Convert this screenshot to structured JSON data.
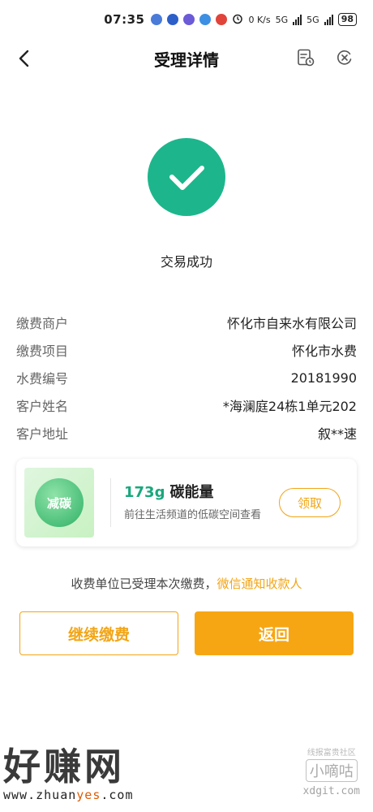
{
  "status_bar": {
    "time": "07:35",
    "net_speed": "0 K/s",
    "sig1": "5G",
    "sig2": "5G",
    "battery": "98"
  },
  "header": {
    "title": "受理详情"
  },
  "success": {
    "text": "交易成功"
  },
  "details": [
    {
      "label": "缴费商户",
      "value": "怀化市自来水有限公司"
    },
    {
      "label": "缴费项目",
      "value": "怀化市水费"
    },
    {
      "label": "水费编号",
      "value": "20181990"
    },
    {
      "label": "客户姓名",
      "value": "*海澜庭24栋1单元202"
    },
    {
      "label": "客户地址",
      "value": "叙**速"
    }
  ],
  "carbon_card": {
    "badge": "减碳",
    "amount": "173g",
    "title": "碳能量",
    "description": "前往生活频道的低碳空间查看",
    "button": "领取"
  },
  "notice": {
    "text": "收费单位已受理本次缴费，",
    "link": "微信通知收款人"
  },
  "buttons": {
    "continue": "继续缴费",
    "back": "返回"
  },
  "watermark": {
    "left_big": "好赚网",
    "left_url_prefix": "www.zhuan",
    "left_url_highlight": "yes",
    "left_url_suffix": ".com",
    "right_top": "线报富贵社区",
    "right_mid": "小嘀咕",
    "right_bottom": "xdgit.com"
  },
  "colors": {
    "success_green": "#1db68c",
    "accent_orange": "#f2a516",
    "carbon_green": "#1aa77d"
  }
}
